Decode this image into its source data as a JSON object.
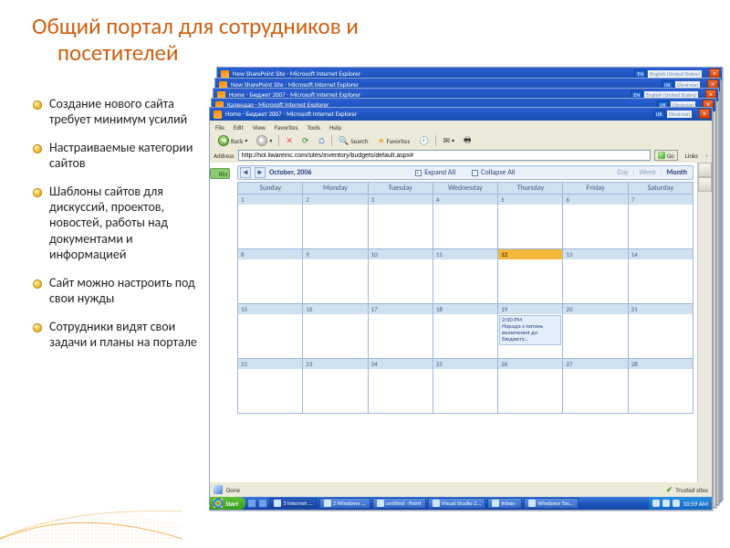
{
  "title": {
    "line1": "Общий портал для сотрудников и",
    "line2": "посетителей"
  },
  "bullets": [
    "Создание нового сайта требует минимум усилий",
    "Настраиваемые категории сайтов",
    "Шаблоны сайтов для дискуссий, проектов, новостей, работы над документами и информацией",
    "Сайт можно настроить под свои нужды",
    "Сотрудники видят свои задачи и планы на портале"
  ],
  "windows_back": [
    {
      "title": "New SharePoint Site - Microsoft Internet Explorer",
      "lang_badge": "EN",
      "lang_text": "English (United States)"
    },
    {
      "title": "New SharePoint Site - Microsoft Internet Explorer",
      "lang_badge": "UK",
      "lang_text": "Ukrainian"
    },
    {
      "title": "Home - Бюджет 2007 - Microsoft Internet Explorer",
      "lang_badge": "EN",
      "lang_text": "English (United States)"
    },
    {
      "title": "Календар - Microsoft Internet Explorer",
      "lang_badge": "UK",
      "lang_text": "Ukrainian"
    }
  ],
  "front": {
    "title": "Home - Бюджет 2007 - Microsoft Internet Explorer",
    "lang_badge": "UK",
    "lang_text": "Ukrainian",
    "menu": [
      "File",
      "Edit",
      "View",
      "Favorites",
      "Tools",
      "Help"
    ],
    "toolbar": {
      "back": "Back",
      "search": "Search",
      "favorites": "Favorites"
    },
    "address_label": "Address",
    "address_value": "http://hol.liwareinc.com/sites/inventory/budgets/default.aspx#",
    "go": "Go",
    "links": "Links",
    "bin": "Bin",
    "control": {
      "month": "October, 2006",
      "expand": "Expand All",
      "collapse": "Collapse All",
      "views": {
        "day": "Day",
        "week": "Week",
        "month": "Month"
      }
    },
    "calendar": {
      "headers": [
        "Sunday",
        "Monday",
        "Tuesday",
        "Wednesday",
        "Thursday",
        "Friday",
        "Saturday"
      ],
      "weeks": [
        [
          {
            "n": "1"
          },
          {
            "n": "2"
          },
          {
            "n": "3"
          },
          {
            "n": "4"
          },
          {
            "n": "5"
          },
          {
            "n": "6"
          },
          {
            "n": "7"
          }
        ],
        [
          {
            "n": "8"
          },
          {
            "n": "9"
          },
          {
            "n": "10"
          },
          {
            "n": "11"
          },
          {
            "n": "12",
            "today": true
          },
          {
            "n": "13"
          },
          {
            "n": "14"
          }
        ],
        [
          {
            "n": "15"
          },
          {
            "n": "16"
          },
          {
            "n": "17"
          },
          {
            "n": "18"
          },
          {
            "n": "19",
            "event": {
              "time": "2:00 PM",
              "text": "Нарада з питань включення до бюджету..."
            }
          },
          {
            "n": "20"
          },
          {
            "n": "21"
          }
        ],
        [
          {
            "n": "22"
          },
          {
            "n": "23"
          },
          {
            "n": "24"
          },
          {
            "n": "25"
          },
          {
            "n": "26"
          },
          {
            "n": "27"
          },
          {
            "n": "28"
          }
        ]
      ]
    },
    "status": {
      "done": "Done",
      "trusted": "Trusted sites"
    },
    "taskbar": {
      "start": "Start",
      "tasks": [
        "3 Internet ...",
        "2 Windows ...",
        "untitled - Paint",
        "Visual Studio 2...",
        "Inbox - <Ow...",
        "Windows Tas..."
      ],
      "clock": "10:59 AM"
    }
  }
}
